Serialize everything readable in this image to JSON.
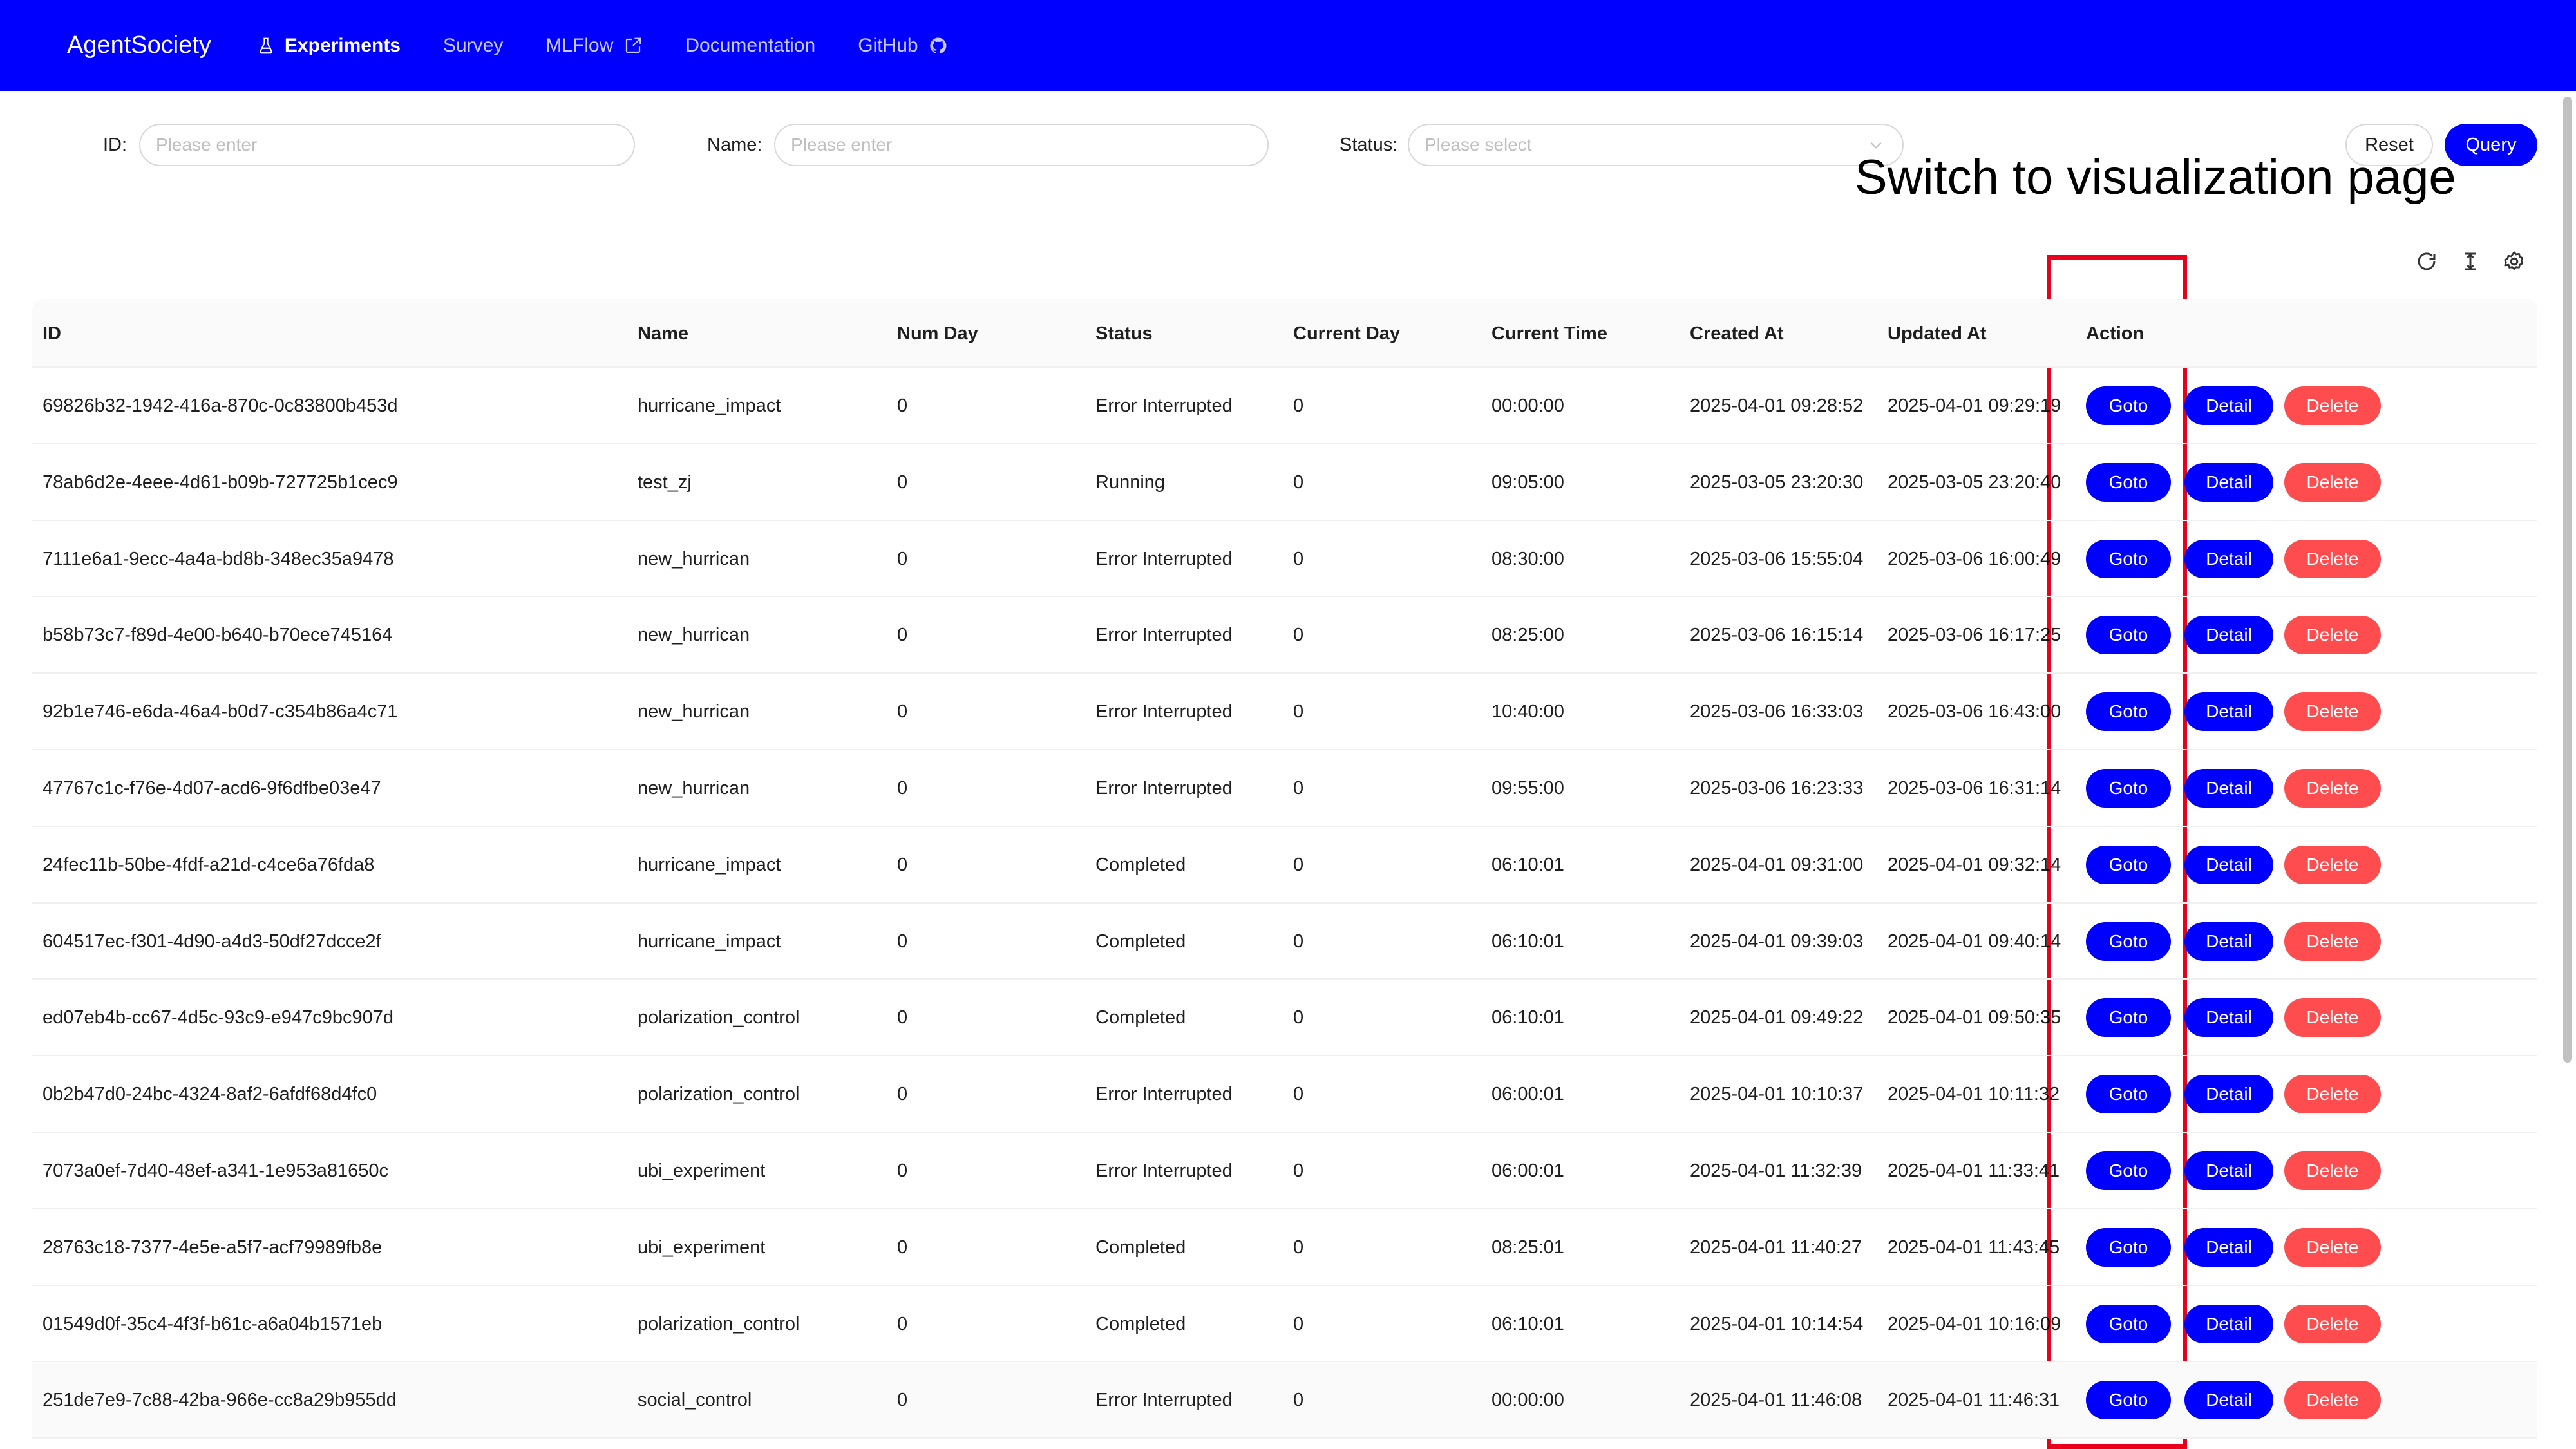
{
  "header": {
    "brand": "AgentSociety",
    "nav": [
      {
        "label": "Experiments",
        "icon": "flask-icon",
        "active": true
      },
      {
        "label": "Survey"
      },
      {
        "label": "MLFlow",
        "icon_after": "external-link-icon"
      },
      {
        "label": "Documentation"
      },
      {
        "label": "GitHub",
        "icon_after": "github-icon"
      }
    ]
  },
  "search": {
    "id_label": "ID",
    "id_placeholder": "Please enter",
    "name_label": "Name",
    "name_placeholder": "Please enter",
    "status_label": "Status",
    "status_placeholder": "Please select",
    "reset_label": "Reset",
    "query_label": "Query"
  },
  "annotation": "Switch to visualization page",
  "toolbar": [
    "reload-icon",
    "column-height-icon",
    "setting-icon"
  ],
  "table": {
    "columns": [
      "ID",
      "Name",
      "Num Day",
      "Status",
      "Current Day",
      "Current Time",
      "Created At",
      "Updated At",
      "Action"
    ],
    "actions": {
      "goto": "Goto",
      "detail": "Detail",
      "delete": "Delete"
    },
    "rows": [
      {
        "id": "69826b32-1942-416a-870c-0c83800b453d",
        "name": "hurricane_impact",
        "num_day": "0",
        "status": "Error Interrupted",
        "current_day": "0",
        "current_time": "00:00:00",
        "created_at": "2025-04-01 09:28:52",
        "updated_at": "2025-04-01 09:29:19"
      },
      {
        "id": "78ab6d2e-4eee-4d61-b09b-727725b1cec9",
        "name": "test_zj",
        "num_day": "0",
        "status": "Running",
        "current_day": "0",
        "current_time": "09:05:00",
        "created_at": "2025-03-05 23:20:30",
        "updated_at": "2025-03-05 23:20:40"
      },
      {
        "id": "7111e6a1-9ecc-4a4a-bd8b-348ec35a9478",
        "name": "new_hurrican",
        "num_day": "0",
        "status": "Error Interrupted",
        "current_day": "0",
        "current_time": "08:30:00",
        "created_at": "2025-03-06 15:55:04",
        "updated_at": "2025-03-06 16:00:49"
      },
      {
        "id": "b58b73c7-f89d-4e00-b640-b70ece745164",
        "name": "new_hurrican",
        "num_day": "0",
        "status": "Error Interrupted",
        "current_day": "0",
        "current_time": "08:25:00",
        "created_at": "2025-03-06 16:15:14",
        "updated_at": "2025-03-06 16:17:25"
      },
      {
        "id": "92b1e746-e6da-46a4-b0d7-c354b86a4c71",
        "name": "new_hurrican",
        "num_day": "0",
        "status": "Error Interrupted",
        "current_day": "0",
        "current_time": "10:40:00",
        "created_at": "2025-03-06 16:33:03",
        "updated_at": "2025-03-06 16:43:00"
      },
      {
        "id": "47767c1c-f76e-4d07-acd6-9f6dfbe03e47",
        "name": "new_hurrican",
        "num_day": "0",
        "status": "Error Interrupted",
        "current_day": "0",
        "current_time": "09:55:00",
        "created_at": "2025-03-06 16:23:33",
        "updated_at": "2025-03-06 16:31:14"
      },
      {
        "id": "24fec11b-50be-4fdf-a21d-c4ce6a76fda8",
        "name": "hurricane_impact",
        "num_day": "0",
        "status": "Completed",
        "current_day": "0",
        "current_time": "06:10:01",
        "created_at": "2025-04-01 09:31:00",
        "updated_at": "2025-04-01 09:32:14"
      },
      {
        "id": "604517ec-f301-4d90-a4d3-50df27dcce2f",
        "name": "hurricane_impact",
        "num_day": "0",
        "status": "Completed",
        "current_day": "0",
        "current_time": "06:10:01",
        "created_at": "2025-04-01 09:39:03",
        "updated_at": "2025-04-01 09:40:14"
      },
      {
        "id": "ed07eb4b-cc67-4d5c-93c9-e947c9bc907d",
        "name": "polarization_control",
        "num_day": "0",
        "status": "Completed",
        "current_day": "0",
        "current_time": "06:10:01",
        "created_at": "2025-04-01 09:49:22",
        "updated_at": "2025-04-01 09:50:35"
      },
      {
        "id": "0b2b47d0-24bc-4324-8af2-6afdf68d4fc0",
        "name": "polarization_control",
        "num_day": "0",
        "status": "Error Interrupted",
        "current_day": "0",
        "current_time": "06:00:01",
        "created_at": "2025-04-01 10:10:37",
        "updated_at": "2025-04-01 10:11:32"
      },
      {
        "id": "7073a0ef-7d40-48ef-a341-1e953a81650c",
        "name": "ubi_experiment",
        "num_day": "0",
        "status": "Error Interrupted",
        "current_day": "0",
        "current_time": "06:00:01",
        "created_at": "2025-04-01 11:32:39",
        "updated_at": "2025-04-01 11:33:41"
      },
      {
        "id": "28763c18-7377-4e5e-a5f7-acf79989fb8e",
        "name": "ubi_experiment",
        "num_day": "0",
        "status": "Completed",
        "current_day": "0",
        "current_time": "08:25:01",
        "created_at": "2025-04-01 11:40:27",
        "updated_at": "2025-04-01 11:43:45"
      },
      {
        "id": "01549d0f-35c4-4f3f-b61c-a6a04b1571eb",
        "name": "polarization_control",
        "num_day": "0",
        "status": "Completed",
        "current_day": "0",
        "current_time": "06:10:01",
        "created_at": "2025-04-01 10:14:54",
        "updated_at": "2025-04-01 10:16:09"
      },
      {
        "id": "251de7e9-7c88-42ba-966e-cc8a29b955dd",
        "name": "social_control",
        "num_day": "0",
        "status": "Error Interrupted",
        "current_day": "0",
        "current_time": "00:00:00",
        "created_at": "2025-04-01 11:46:08",
        "updated_at": "2025-04-01 11:46:31"
      }
    ]
  },
  "colors": {
    "primary": "#0000ff",
    "danger": "#ff4d4f",
    "annotation": "#e8001c"
  }
}
